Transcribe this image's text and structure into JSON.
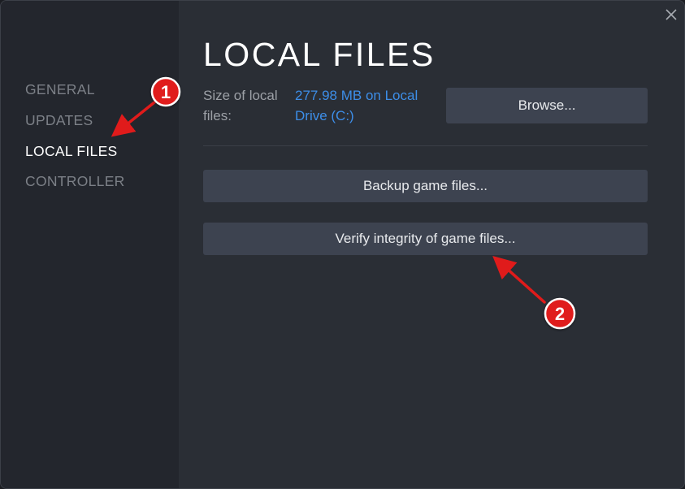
{
  "sidebar": {
    "items": [
      {
        "label": "GENERAL",
        "active": false
      },
      {
        "label": "UPDATES",
        "active": false
      },
      {
        "label": "LOCAL FILES",
        "active": true
      },
      {
        "label": "CONTROLLER",
        "active": false
      }
    ]
  },
  "window": {
    "close_icon": "close-icon"
  },
  "main": {
    "title": "LOCAL FILES",
    "size_label": "Size of local files:",
    "size_value": "277.98 MB on Local Drive (C:)",
    "browse_label": "Browse...",
    "backup_label": "Backup game files...",
    "verify_label": "Verify integrity of game files..."
  },
  "annotations": [
    {
      "number": "1"
    },
    {
      "number": "2"
    }
  ],
  "colors": {
    "background": "#2a2e35",
    "sidebar": "#23262d",
    "button": "#3d4350",
    "link": "#3d8ee8",
    "annotation_red": "#e01b1b"
  }
}
